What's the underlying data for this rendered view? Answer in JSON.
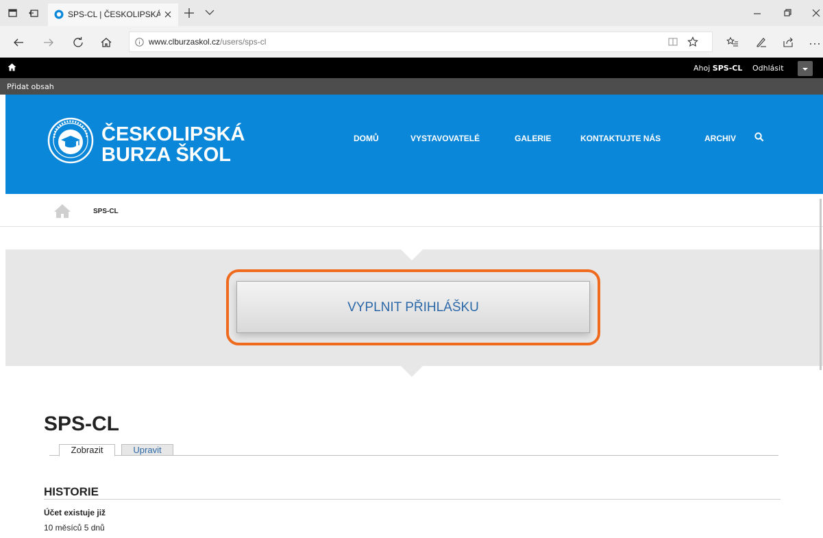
{
  "browser": {
    "tab_title": "SPS-CL | ČESKOLIPSKÁ B",
    "url_host": "www.clburzaskol.cz",
    "url_path": "/users/sps-cl"
  },
  "toolbar": {
    "greeting_prefix": "Ahoj",
    "username": "SPS-CL",
    "logout": "Odhlásit",
    "add_content": "Přidat obsah"
  },
  "site": {
    "name_line1": "ČESKOLIPSKÁ",
    "name_line2": "BURZA ŠKOL",
    "nav": [
      "DOMŮ",
      "VYSTAVOVATELÉ",
      "GALERIE",
      "KONTAKTUJTE NÁS",
      "ARCHIV"
    ]
  },
  "breadcrumb": {
    "current": "SPS-CL"
  },
  "cta": {
    "label": "VYPLNIT PŘIHLÁŠKU"
  },
  "page": {
    "title": "SPS-CL",
    "tabs": [
      "Zobrazit",
      "Upravit"
    ],
    "history_heading": "HISTORIE",
    "account_label": "Účet existuje již",
    "account_age": "10 měsíců 5 dnů"
  },
  "colors": {
    "header_blue": "#0a87d8",
    "highlight_orange": "#f06a1d",
    "link_blue": "#2b68a8"
  }
}
